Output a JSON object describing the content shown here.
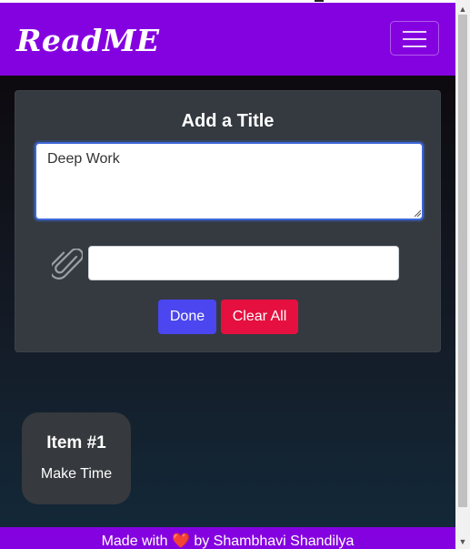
{
  "navbar": {
    "brand": "ReadME",
    "toggler_icon": "hamburger-menu-icon",
    "color": "#8502e0"
  },
  "form": {
    "heading": "Add a Title",
    "title_value": "Deep Work",
    "attach_icon": "paperclip-icon",
    "file_value": "",
    "done_label": "Done",
    "clear_label": "Clear All",
    "done_color": "#4b46f0",
    "clear_color": "#e5103f"
  },
  "items": [
    {
      "title": "Item #1",
      "description": "Make Time"
    }
  ],
  "footer": {
    "prefix": "Made with",
    "heart": "❤️",
    "suffix": "by Shambhavi Shandilya"
  }
}
